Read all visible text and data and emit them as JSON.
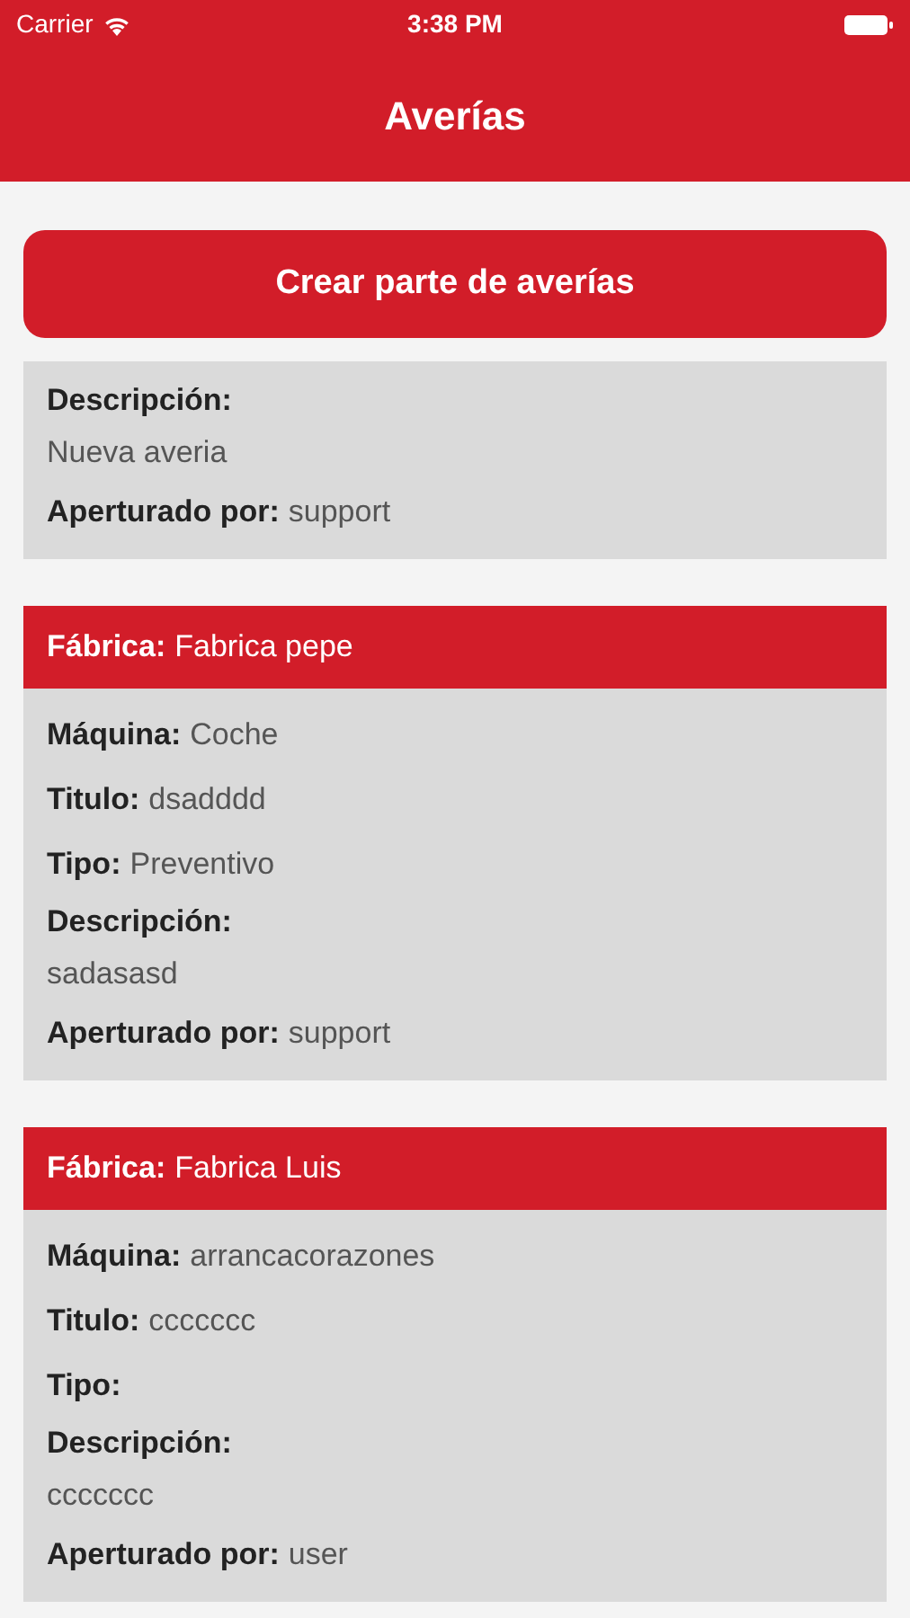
{
  "status_bar": {
    "carrier": "Carrier",
    "time": "3:38 PM"
  },
  "nav": {
    "title": "Averías"
  },
  "create_button": "Crear parte de averías",
  "cards": [
    {
      "fields": [
        {
          "kind": "block",
          "label": "Descripción:",
          "value": "Nueva averia"
        },
        {
          "kind": "inline",
          "label": "Aperturado por:",
          "value": "support"
        }
      ]
    },
    {
      "header": {
        "label": "Fábrica:",
        "value": "Fabrica pepe"
      },
      "fields": [
        {
          "kind": "inline",
          "label": "Máquina:",
          "value": "Coche"
        },
        {
          "kind": "inline",
          "label": "Titulo:",
          "value": "dsadddd"
        },
        {
          "kind": "inline",
          "label": "Tipo:",
          "value": "Preventivo"
        },
        {
          "kind": "block",
          "label": "Descripción:",
          "value": "sadasasd"
        },
        {
          "kind": "inline",
          "label": "Aperturado por:",
          "value": "support"
        }
      ]
    },
    {
      "header": {
        "label": "Fábrica:",
        "value": "Fabrica Luis"
      },
      "fields": [
        {
          "kind": "inline",
          "label": "Máquina:",
          "value": "arrancacorazones"
        },
        {
          "kind": "inline",
          "label": "Titulo:",
          "value": "ccccccc"
        },
        {
          "kind": "inline",
          "label": "Tipo:"
        },
        {
          "kind": "block",
          "label": "Descripción:",
          "value": "ccccccc"
        },
        {
          "kind": "inline",
          "label": "Aperturado por:",
          "value": "user"
        }
      ]
    }
  ]
}
